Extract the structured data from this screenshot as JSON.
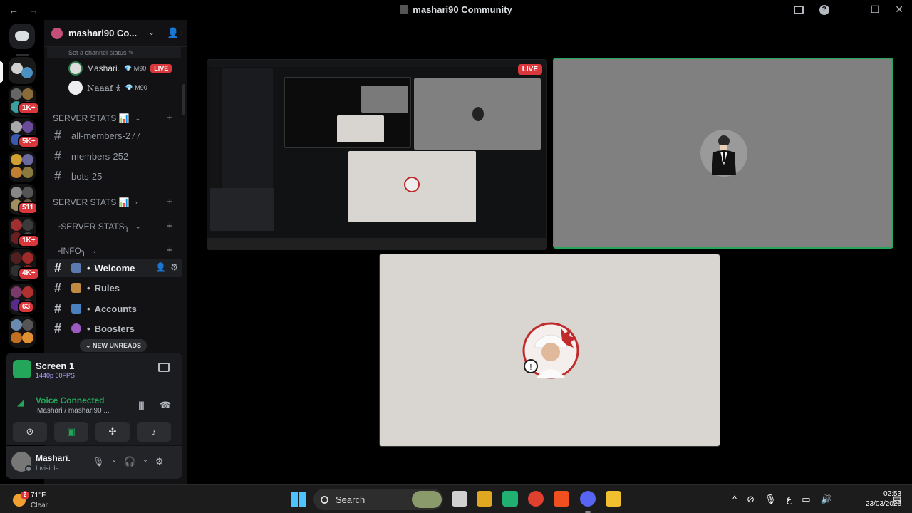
{
  "window": {
    "title": "mashari90 Community",
    "back": "←",
    "forward": "→",
    "minimize": "—",
    "maximize": "☐",
    "close": "✕"
  },
  "rail": {
    "badges": [
      "1K+",
      "5K+",
      "511",
      "1K+",
      "4K+",
      "63"
    ]
  },
  "server": {
    "name": "mashari90 Co...",
    "chevron": "⌄",
    "invite": "👤+"
  },
  "voice_channel": {
    "status_prompt": "Set a channel status ✎",
    "users": [
      {
        "name": "Mashari.",
        "tag": "💎 M90",
        "live": "LIVE"
      },
      {
        "name": "Naaaf 𐀪",
        "tag": "💎 M90"
      }
    ]
  },
  "categories": [
    {
      "label": "SERVER STATS 📊",
      "chevron": "⌄"
    },
    {
      "label": "SERVER STATS 📊",
      "chevron": "›"
    },
    {
      "label": "╭SERVER STATS╮",
      "chevron": "⌄"
    },
    {
      "label": "╭INFO╮",
      "chevron": "⌄"
    }
  ],
  "stat_channels": [
    "all-members-277",
    "members-252",
    "bots-25"
  ],
  "info_channels": [
    "Welcome",
    "Rules",
    "Accounts",
    "Boosters"
  ],
  "new_unreads": "⌄ NEW UNREADS",
  "stream": {
    "title": "Screen 1",
    "quality": "1440p 60FPS"
  },
  "voice": {
    "status": "Voice Connected",
    "location": "Mashari / mashari90 ..."
  },
  "user": {
    "name": "Mashari.",
    "status": "Invisible"
  },
  "tiles": {
    "live": "LIVE"
  },
  "taskbar": {
    "temperature": "71°F",
    "condition": "Clear",
    "weather_badge": "2",
    "search": "Search",
    "time": "02:53",
    "date": "23/03/2026",
    "lang": "ع"
  }
}
